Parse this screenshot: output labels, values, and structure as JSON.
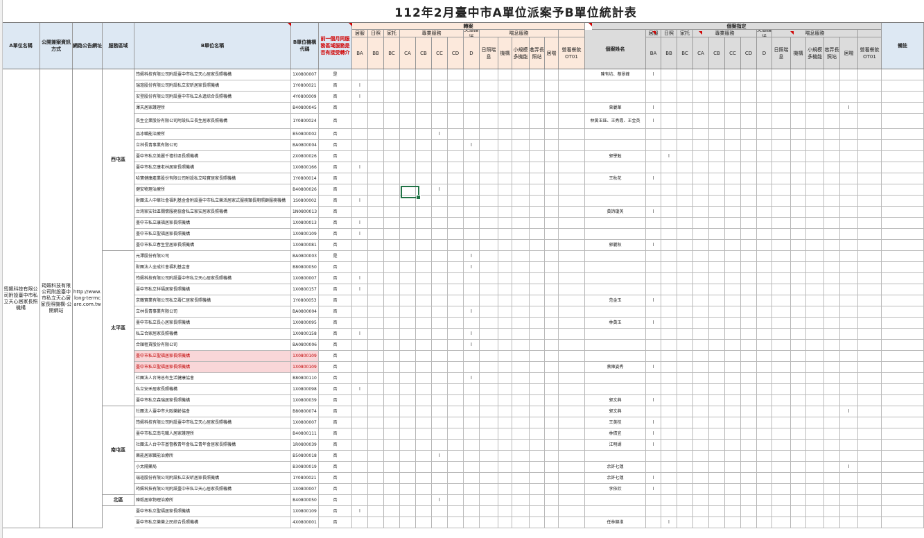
{
  "title": "112年2月臺中市A單位派案予B單位統計表",
  "headers": {
    "a_unit_name": "A單位名稱",
    "info_method": "公開兼案資訊方式",
    "website": "網路公告網址",
    "service_area": "服務區域",
    "b_unit_name": "B單位名稱",
    "b_code": "B單位機構代碼",
    "month_accept": "前一個月同服務區域服務是否有接受轉介",
    "group_refer": "轉案",
    "group_case": "個案指定",
    "sub_home": "居服",
    "sub_day": "日照",
    "sub_family": "家托",
    "sub_pro": "專業服務",
    "sub_trans": "交通接送",
    "sub_respite": "喘息服務",
    "case_name": "個案姓名",
    "remark": "備註",
    "cols": [
      "BA",
      "BB",
      "BC",
      "CA",
      "CB",
      "CC",
      "CD",
      "D",
      "日照喘息",
      "機構",
      "小規模多機能",
      "巷弄長照站",
      "居喘",
      "營養餐飲OT01"
    ]
  },
  "a_unit": {
    "name": "筠姵科技有限公司附設臺中市私立天心居家長照機構",
    "info_method": "筠姵科技有限公司附設臺中市私立天心居家長照機構-公開網站",
    "website": "http://www.long-termcare.com.tw"
  },
  "areas": [
    {
      "name": "西屯區",
      "rows": 16
    },
    {
      "name": "太平區",
      "rows": 14
    },
    {
      "name": "南屯區",
      "rows": 8
    },
    {
      "name": "北區",
      "rows": 4
    }
  ],
  "rows": [
    {
      "name": "筠姵科技有限公司附設臺中市私立天心居家長照機構",
      "code": "1X0800007",
      "accept": "是",
      "case": "陳有坊、蔡景峰",
      "ticks": [],
      "cticks": [
        "BA"
      ]
    },
    {
      "name": "瑞瑄股份有限公司附設私立安昕居家長照機構",
      "code": "1Y0800021",
      "accept": "否",
      "case": "",
      "ticks": [
        "BA"
      ],
      "cticks": []
    },
    {
      "name": "安登股份有限公司附設臺中市私立永進綜合長照機構",
      "code": "4Y0800009",
      "accept": "否",
      "case": "",
      "ticks": [
        "BA"
      ],
      "cticks": []
    },
    {
      "name": "渾天居家護理所",
      "code": "B40800045",
      "accept": "否",
      "case": "曾麗華",
      "ticks": [],
      "cticks": [
        "BA",
        "居喘"
      ]
    },
    {
      "name": "長生企業股份有限公司附設私立長生居家長照機構",
      "code": "1Y0800024",
      "accept": "否",
      "case": "林黃玉鈺、王秀霞、王金英",
      "ticks": [],
      "cticks": [
        "BA"
      ]
    },
    {
      "name": "品冰職能治療所",
      "code": "B50800002",
      "accept": "否",
      "case": "",
      "ticks": [
        "CC"
      ],
      "cticks": []
    },
    {
      "name": "立林長青事業有限公司",
      "code": "BA0800004",
      "accept": "否",
      "case": "",
      "ticks": [
        "D"
      ],
      "cticks": []
    },
    {
      "name": "臺中市私立美麗千禧社區長照機構",
      "code": "2X0800026",
      "accept": "否",
      "case": "郭學勉",
      "ticks": [],
      "cticks": [
        "BB"
      ]
    },
    {
      "name": "臺中市私立康老林居家長照機構",
      "code": "1X0800166",
      "accept": "否",
      "case": "",
      "ticks": [
        "BA"
      ],
      "cticks": []
    },
    {
      "name": "哈寶健康產業股份有限公司附設私立哈寶居家長照機構",
      "code": "1Y0800014",
      "accept": "否",
      "case": "王秋花",
      "ticks": [],
      "cticks": [
        "BA"
      ]
    },
    {
      "name": "健安物理治療所",
      "code": "B40800026",
      "accept": "否",
      "case": "",
      "ticks": [
        "CC"
      ],
      "cticks": []
    },
    {
      "name": "財團法人中華社會福利基金會附設臺中市私立樂活居家式服務類長期照顧服務機構",
      "code": "1S0800002",
      "accept": "否",
      "case": "",
      "ticks": [
        "BA"
      ],
      "cticks": []
    },
    {
      "name": "台灣家安社區關懷服務協會私立家安居家長照機構",
      "code": "1N0800013",
      "accept": "否",
      "case": "黃詩瓊英",
      "ticks": [],
      "cticks": [
        "BA"
      ]
    },
    {
      "name": "臺中市私立康福居家長照機構",
      "code": "1X0800013",
      "accept": "否",
      "case": "",
      "ticks": [
        "BA"
      ],
      "cticks": []
    },
    {
      "name": "臺中市私立聖福居家長照機構",
      "code": "1X0800109",
      "accept": "否",
      "case": "",
      "ticks": [
        "BA"
      ],
      "cticks": []
    },
    {
      "name": "臺中市私立春生堂居家長照機構",
      "code": "1X0800081",
      "accept": "否",
      "case": "郭麗秋",
      "ticks": [],
      "cticks": [
        "BA"
      ]
    },
    {
      "name": "元澤股份有限公司",
      "code": "BA0800003",
      "accept": "是",
      "case": "",
      "ticks": [
        "D"
      ],
      "cticks": []
    },
    {
      "name": "財團法人全成社會福利基金會",
      "code": "B80800050",
      "accept": "否",
      "case": "",
      "ticks": [
        "D"
      ],
      "cticks": []
    },
    {
      "name": "筠姵科技有限公司附設臺中市私立天心居家長照機構",
      "code": "1X0800007",
      "accept": "否",
      "case": "",
      "ticks": [
        "BA"
      ],
      "cticks": []
    },
    {
      "name": "臺中市私立祥福居家長照機構",
      "code": "1X0800157",
      "accept": "否",
      "case": "",
      "ticks": [
        "BA"
      ],
      "cticks": []
    },
    {
      "name": "京鶴實業有限公司私立壽仁居家長照機構",
      "code": "1Y0800053",
      "accept": "否",
      "case": "范金玉",
      "ticks": [],
      "cticks": [
        "BA"
      ]
    },
    {
      "name": "立林長青事業有限公司",
      "code": "BA0800004",
      "accept": "否",
      "case": "",
      "ticks": [
        "D"
      ],
      "cticks": []
    },
    {
      "name": "臺中市私立長心居家長照機構",
      "code": "1X0800095",
      "accept": "否",
      "case": "林黃玉",
      "ticks": [],
      "cticks": [
        "BA"
      ]
    },
    {
      "name": "私立合家居家長照機構",
      "code": "1X0800158",
      "accept": "否",
      "case": "",
      "ticks": [
        "BA",
        "D"
      ],
      "cticks": []
    },
    {
      "name": "合順租賃股份有限公司",
      "code": "BA0800006",
      "accept": "否",
      "case": "",
      "ticks": [
        "D"
      ],
      "cticks": []
    },
    {
      "name": "臺中市私立聖福居家長照機構",
      "code": "1X0800109",
      "accept": "否",
      "case": "",
      "ticks": [],
      "cticks": [],
      "pink": true
    },
    {
      "name": "臺中市私立聖福居家長照機構",
      "code": "1X0800109",
      "accept": "否",
      "case": "蔡陳姿秀",
      "ticks": [],
      "cticks": [
        "BA"
      ],
      "pink": true
    },
    {
      "name": "社團法人台灣总有生活健康協會",
      "code": "B80800110",
      "accept": "否",
      "case": "",
      "ticks": [
        "D"
      ],
      "cticks": []
    },
    {
      "name": "私立安禾居家長照機構",
      "code": "1X0800098",
      "accept": "否",
      "case": "",
      "ticks": [
        "BA"
      ],
      "cticks": []
    },
    {
      "name": "臺中市私立森瑞居家長照機構",
      "code": "1X0800039",
      "accept": "否",
      "case": "郭文典",
      "ticks": [],
      "cticks": [
        "BA"
      ]
    },
    {
      "name": "社團法人臺中市大阪樂齡協會",
      "code": "B80800074",
      "accept": "否",
      "case": "郭文典",
      "ticks": [],
      "cticks": [
        "居喘"
      ]
    },
    {
      "name": "筠姵科技有限公司附設臺中市私立天心居家長照機構",
      "code": "1X0800007",
      "accept": "否",
      "case": "王美枝",
      "ticks": [],
      "cticks": [
        "BA"
      ]
    },
    {
      "name": "臺中市私立南屯職人居家護理所",
      "code": "B40800111",
      "accept": "否",
      "case": "林倩宜",
      "ticks": [],
      "cticks": [
        "BA"
      ]
    },
    {
      "name": "社團法人台中市基督教青年會私立青年會居家長照機構",
      "code": "1R0800039",
      "accept": "否",
      "case": "江明湖",
      "ticks": [],
      "cticks": [
        "BA"
      ]
    },
    {
      "name": "樂能居家職能治療所",
      "code": "B50800018",
      "accept": "否",
      "case": "",
      "ticks": [
        "CC"
      ],
      "cticks": []
    },
    {
      "name": "小太陽藥局",
      "code": "B30800019",
      "accept": "否",
      "case": "余許七蓮",
      "ticks": [],
      "cticks": [
        "居喘"
      ]
    },
    {
      "name": "瑞瑄股份有限公司附設私立安昕居家長照機構",
      "code": "1Y0800021",
      "accept": "否",
      "case": "余許七蓮",
      "ticks": [],
      "cticks": [
        "BA"
      ]
    },
    {
      "name": "筠姵科技有限公司附設臺中市私立天心居家長照機構",
      "code": "1X0800007",
      "accept": "否",
      "case": "李依欣",
      "ticks": [],
      "cticks": [
        "BA"
      ]
    },
    {
      "name": "陳毅居家物理治療所",
      "code": "B40800050",
      "accept": "否",
      "case": "",
      "ticks": [
        "CC"
      ],
      "cticks": []
    },
    {
      "name": "臺中市私立聖福居家長照機構",
      "code": "1X0800109",
      "accept": "否",
      "case": "",
      "ticks": [
        "BA"
      ],
      "cticks": []
    },
    {
      "name": "臺中市私立樂樂之民綜合長照機構",
      "code": "4X0800001",
      "accept": "否",
      "case": "任林錦淮",
      "ticks": [],
      "cticks": [
        "BB"
      ]
    }
  ],
  "tick_mark": "l"
}
